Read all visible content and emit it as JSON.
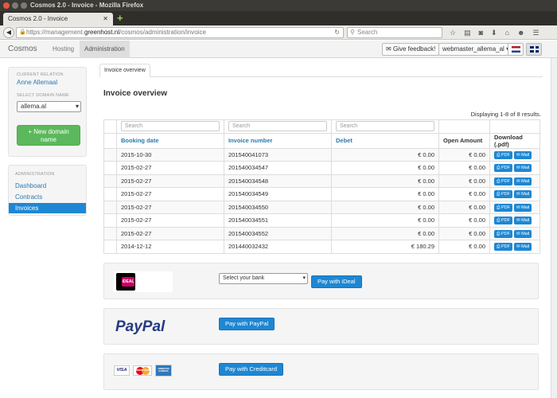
{
  "window": {
    "title": "Cosmos 2.0 - Invoice - Mozilla Firefox"
  },
  "browser": {
    "tab_title": "Cosmos 2.0 - Invoice",
    "url_prefix": "https://management.",
    "url_domain": "greenhost.nl",
    "url_path": "/cosmos/administration/invoice",
    "search_placeholder": "Search"
  },
  "appnav": {
    "brand": "Cosmos",
    "items": [
      {
        "label": "Hosting"
      },
      {
        "label": "Administration"
      }
    ],
    "feedback": "Give feedback!",
    "user": "webmaster_allema_al"
  },
  "sidebar": {
    "current_relation_label": "CURRENT RELATION",
    "relation_name": "Anne Allemaal",
    "select_domain_label": "SELECT DOMAIN NAME",
    "domain_value": "allema.al",
    "new_domain_line1": "New domain",
    "new_domain_line2": "name",
    "admin_label": "ADMINISTRATION",
    "menu": [
      {
        "label": "Dashboard"
      },
      {
        "label": "Contracts"
      },
      {
        "label": "Invoices"
      }
    ]
  },
  "content": {
    "tab": "Invoice overview",
    "heading": "Invoice overview",
    "displaying": "Displaying 1-8 of 8 results.",
    "search_placeholder": "Search",
    "columns": [
      "Booking date",
      "Invoice number",
      "Debet",
      "Open Amount",
      "Download (.pdf)"
    ],
    "pdf_label": "PDF",
    "mail_label": "Mail",
    "rows": [
      {
        "date": "2015-10-30",
        "number": "201540041073",
        "debet": "€ 0.00",
        "open": "€ 0.00"
      },
      {
        "date": "2015-02-27",
        "number": "201540034547",
        "debet": "€ 0.00",
        "open": "€ 0.00"
      },
      {
        "date": "2015-02-27",
        "number": "201540034548",
        "debet": "€ 0.00",
        "open": "€ 0.00"
      },
      {
        "date": "2015-02-27",
        "number": "201540034549",
        "debet": "€ 0.00",
        "open": "€ 0.00"
      },
      {
        "date": "2015-02-27",
        "number": "201540034550",
        "debet": "€ 0.00",
        "open": "€ 0.00"
      },
      {
        "date": "2015-02-27",
        "number": "201540034551",
        "debet": "€ 0.00",
        "open": "€ 0.00"
      },
      {
        "date": "2015-02-27",
        "number": "201540034552",
        "debet": "€ 0.00",
        "open": "€ 0.00"
      },
      {
        "date": "2014-12-12",
        "number": "201440032432",
        "debet": "€ 180.29",
        "open": "€ 0.00"
      }
    ]
  },
  "payments": {
    "ideal_logo": "iDEAL",
    "bank_select": "Select your bank",
    "ideal_button": "Pay with iDeal",
    "paypal_logo": "PayPal",
    "paypal_button": "Pay with PayPal",
    "card_logos": [
      "VISA",
      "MasterCard",
      "AMERICAN EXPRESS"
    ],
    "card_button": "Pay with Creditcard"
  },
  "colors": {
    "primary": "#1e87d3",
    "success": "#5cb85c",
    "link": "#2a7ab0"
  }
}
